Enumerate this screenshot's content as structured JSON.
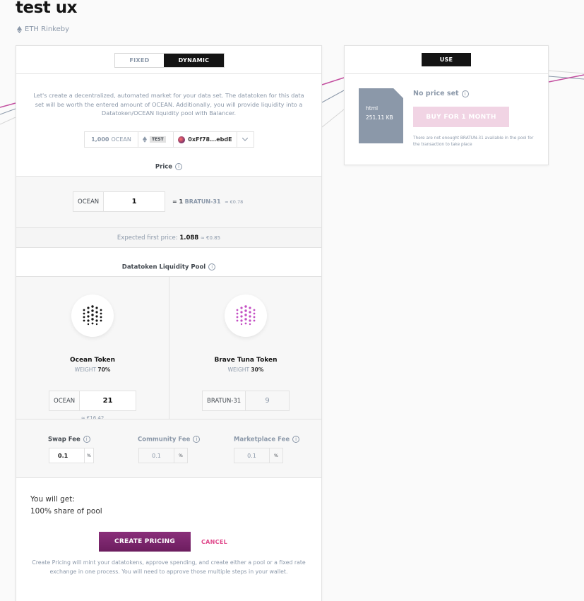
{
  "asset": {
    "title": "test ux",
    "network": "ETH Rinkeby"
  },
  "pricing": {
    "tabs": [
      {
        "label": "FIXED"
      },
      {
        "label": "DYNAMIC"
      }
    ],
    "intro": "Let's create a decentralized, automated market for your data set. The datatoken for this data set will be worth the entered amount of OCEAN. Additionally, you will provide liquidity into a Datatoken/OCEAN liquidity pool with Balancer.",
    "wallet": {
      "amount": "1,000",
      "currency": "OCEAN",
      "network_badge": "TEST",
      "account": "0xFf78...ebdE"
    },
    "price_label": "Price",
    "price": {
      "prefix": "OCEAN",
      "value": "1",
      "equals": "= 1",
      "token": "BRATUN-31",
      "fiat": "≈ €0.78"
    },
    "expected": {
      "label": "Expected first price:",
      "value": "1.088",
      "fiat": "≈ €0.85"
    },
    "pool_label": "Datatoken Liquidity Pool",
    "ocean": {
      "name": "Ocean Token",
      "weight_label": "WEIGHT",
      "weight": "70%",
      "prefix": "OCEAN",
      "value": "21",
      "fiat": "≈ €16.42"
    },
    "datatoken": {
      "name": "Brave Tuna Token",
      "weight_label": "WEIGHT",
      "weight": "30%",
      "prefix": "BRATUN-31",
      "value": "9"
    },
    "fees": [
      {
        "label": "Swap Fee",
        "value": "0.1",
        "unit": "%"
      },
      {
        "label": "Community Fee",
        "value": "0.1",
        "unit": "%"
      },
      {
        "label": "Marketplace Fee",
        "value": "0.1",
        "unit": "%"
      }
    ],
    "you_get_label": "You will get:",
    "you_get_value": "100% share of pool",
    "create_label": "CREATE PRICING",
    "cancel_label": "CANCEL",
    "note": "Create Pricing will mint your datatokens, approve spending, and create either a pool or a fixed rate exchange in one process. You will need to approve those multiple steps in your wallet."
  },
  "use_panel": {
    "tab_label": "USE",
    "file_type": "html",
    "file_size": "251.11 KB",
    "no_price": "No price set",
    "buy_label": "BUY FOR 1 MONTH",
    "warning": "There are not enought BRATUN-31 available in the pool for the transaction to take place"
  }
}
